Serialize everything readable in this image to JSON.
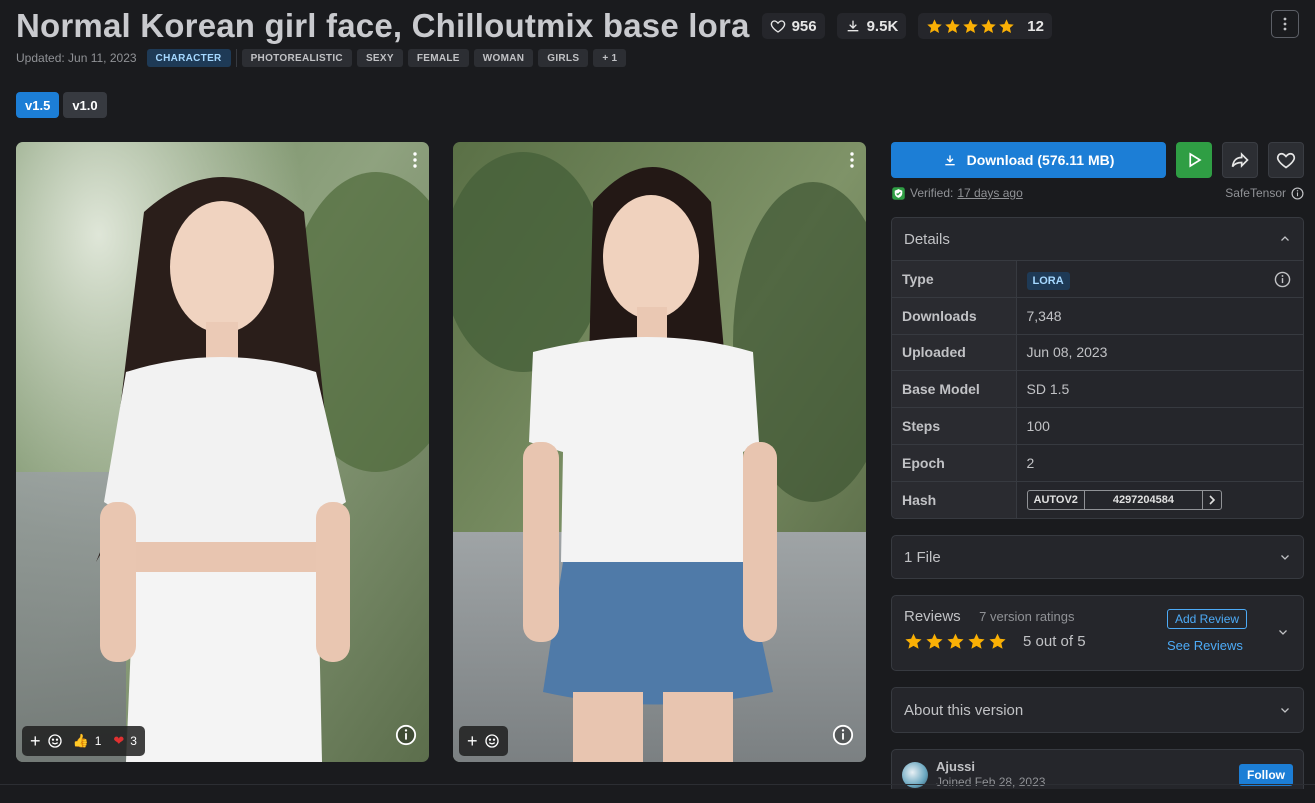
{
  "header": {
    "title": "Normal Korean girl face, Chilloutmix base lora",
    "likes": "956",
    "downloads": "9.5K",
    "rating_count": "12"
  },
  "meta": {
    "updated": "Updated: Jun 11, 2023",
    "category": "CHARACTER",
    "tags": [
      "PHOTOREALISTIC",
      "SEXY",
      "FEMALE",
      "WOMAN",
      "GIRLS",
      "+ 1"
    ]
  },
  "versions": [
    "v1.5",
    "v1.0"
  ],
  "gallery": {
    "card1": {
      "reaction_thumbs": "1",
      "reaction_heart": "3"
    }
  },
  "download": {
    "label": "Download (576.11 MB)",
    "verified_label": "Verified:",
    "verified_time": "17 days ago",
    "safetensor": "SafeTensor"
  },
  "details": {
    "title": "Details",
    "rows": [
      {
        "key": "Type",
        "value": "LORA"
      },
      {
        "key": "Downloads",
        "value": "7,348"
      },
      {
        "key": "Uploaded",
        "value": "Jun 08, 2023"
      },
      {
        "key": "Base Model",
        "value": "SD 1.5"
      },
      {
        "key": "Steps",
        "value": "100"
      },
      {
        "key": "Epoch",
        "value": "2"
      },
      {
        "key": "Hash",
        "value": ""
      }
    ],
    "hash_type": "AUTOV2",
    "hash_value": "4297204584"
  },
  "files": {
    "title": "1 File"
  },
  "reviews": {
    "title": "Reviews",
    "ratings": "7 version ratings",
    "score": "5 out of 5",
    "add": "Add Review",
    "see": "See Reviews"
  },
  "about": {
    "title": "About this version"
  },
  "creator": {
    "name": "Ajussi",
    "joined": "Joined Feb 28, 2023",
    "follow": "Follow"
  },
  "colors": {
    "accent": "#1c7ed6",
    "star": "#fab005",
    "green": "#2f9e44"
  }
}
